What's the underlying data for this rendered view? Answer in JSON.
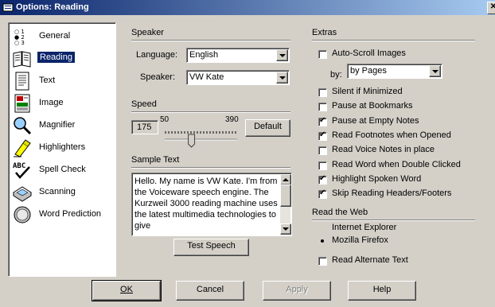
{
  "window": {
    "title": "Options: Reading"
  },
  "nav": {
    "selected": "Reading",
    "items": [
      {
        "label": "General",
        "icon": "list-numbers-icon"
      },
      {
        "label": "Reading",
        "icon": "open-book-icon"
      },
      {
        "label": "Text",
        "icon": "text-page-icon"
      },
      {
        "label": "Image",
        "icon": "image-icon"
      },
      {
        "label": "Magnifier",
        "icon": "magnifier-icon"
      },
      {
        "label": "Highlighters",
        "icon": "highlighter-icon"
      },
      {
        "label": "Spell Check",
        "icon": "spell-check-icon"
      },
      {
        "label": "Scanning",
        "icon": "scanner-icon"
      },
      {
        "label": "Word Prediction",
        "icon": "word-prediction-icon"
      }
    ]
  },
  "speaker": {
    "group_label": "Speaker",
    "language_label": "Language:",
    "language_value": "English",
    "speaker_label": "Speaker:",
    "speaker_value": "VW Kate"
  },
  "speed": {
    "group_label": "Speed",
    "value": "175",
    "min": "50",
    "max": "390",
    "default_button": "Default",
    "slider_fraction": 0.37
  },
  "sample": {
    "group_label": "Sample Text",
    "text": "Hello. My name is VW Kate. I'm from the Voiceware speech engine. The Kurzweil 3000 reading machine uses the latest multimedia technologies to give",
    "test_button": "Test Speech"
  },
  "extras": {
    "group_label": "Extras",
    "auto_scroll": {
      "label": "Auto-Scroll Images",
      "checked": false
    },
    "by_label": "by:",
    "by_value": "by Pages",
    "options": [
      {
        "label": "Silent if Minimized",
        "checked": false
      },
      {
        "label": "Pause at Bookmarks",
        "checked": false
      },
      {
        "label": "Pause at Empty Notes",
        "checked": true
      },
      {
        "label": "Read Footnotes when Opened",
        "checked": true
      },
      {
        "label": "Read Voice Notes in place",
        "checked": false
      },
      {
        "label": "Read Word when Double Clicked",
        "checked": false
      },
      {
        "label": "Highlight Spoken Word",
        "checked": true
      },
      {
        "label": "Skip Reading Headers/Footers",
        "checked": true
      }
    ]
  },
  "web": {
    "group_label": "Read the Web",
    "radio_ie": "Internet Explorer",
    "radio_firefox": "Mozilla Firefox",
    "selected": "Mozilla Firefox",
    "alt_text": {
      "label": "Read Alternate Text",
      "checked": false
    }
  },
  "footer": {
    "ok": "OK",
    "cancel": "Cancel",
    "apply": "Apply",
    "help": "Help"
  }
}
